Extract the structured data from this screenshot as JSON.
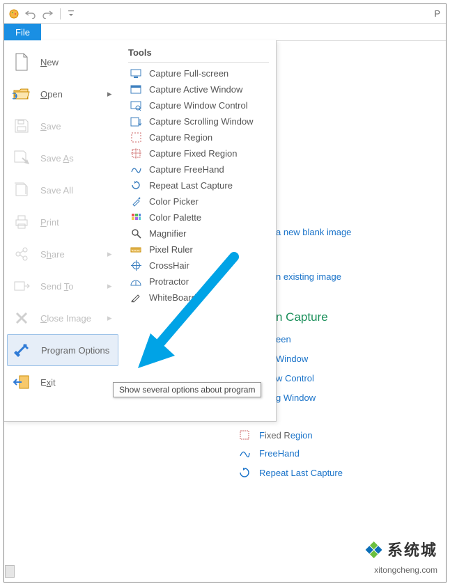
{
  "titlebar": {
    "right_letter": "P"
  },
  "tabs": {
    "file": "File"
  },
  "file_menu": {
    "new": {
      "label": "New",
      "enabled": true,
      "submenu": false
    },
    "open": {
      "label": "Open",
      "enabled": true,
      "submenu": true
    },
    "save": {
      "label": "Save",
      "enabled": false,
      "submenu": false
    },
    "save_as": {
      "label": "Save As",
      "enabled": false,
      "submenu": false
    },
    "save_all": {
      "label": "Save All",
      "enabled": false,
      "submenu": false
    },
    "print": {
      "label": "Print",
      "enabled": false,
      "submenu": false
    },
    "share": {
      "label": "Share",
      "enabled": false,
      "submenu": true
    },
    "send_to": {
      "label": "Send To",
      "enabled": false,
      "submenu": true
    },
    "close_image": {
      "label": "Close Image",
      "enabled": false,
      "submenu": true
    },
    "program_options": {
      "label": "Program Options",
      "enabled": true,
      "submenu": false,
      "highlight": true
    },
    "exit": {
      "label": "Exit",
      "enabled": true,
      "submenu": false
    }
  },
  "tools_panel": {
    "header": "Tools",
    "items": [
      {
        "id": "capture-full-screen",
        "label": "Capture Full-screen"
      },
      {
        "id": "capture-active-window",
        "label": "Capture Active Window"
      },
      {
        "id": "capture-window-control",
        "label": "Capture Window Control"
      },
      {
        "id": "capture-scrolling",
        "label": "Capture Scrolling Window"
      },
      {
        "id": "capture-region",
        "label": "Capture Region"
      },
      {
        "id": "capture-fixed-region",
        "label": "Capture Fixed Region"
      },
      {
        "id": "capture-freehand",
        "label": "Capture FreeHand"
      },
      {
        "id": "repeat-last",
        "label": "Repeat Last Capture"
      },
      {
        "id": "color-picker",
        "label": "Color Picker"
      },
      {
        "id": "color-palette",
        "label": "Color Palette"
      },
      {
        "id": "magnifier",
        "label": "Magnifier"
      },
      {
        "id": "pixel-ruler",
        "label": "Pixel Ruler"
      },
      {
        "id": "crosshair",
        "label": "CrossHair"
      },
      {
        "id": "protractor",
        "label": "Protractor"
      },
      {
        "id": "whiteboard",
        "label": "WhiteBoard"
      }
    ]
  },
  "tooltip": {
    "text": "Show several options about program"
  },
  "underlay": {
    "line1_suffix": "a new blank image",
    "line2_suffix": "n existing image",
    "section_frag": "n Capture",
    "frag_a": "een",
    "frag_b": "Window",
    "frag_c": "w Control",
    "frag_d": "g Window",
    "region": {
      "label_frag": "egion"
    },
    "freehand": {
      "label": "FreeHand"
    },
    "repeat": {
      "label": "Repeat Last Capture"
    }
  },
  "brand": {
    "cn": "系统城",
    "url": "xitongcheng.com"
  }
}
